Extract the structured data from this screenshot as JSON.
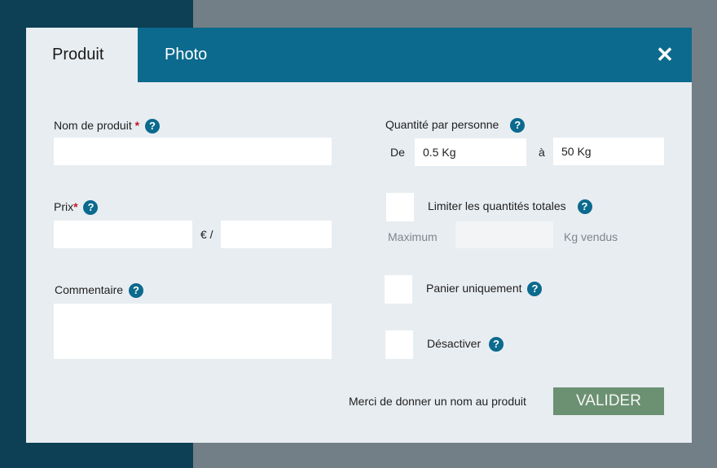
{
  "tabs": {
    "produit": "Produit",
    "photo": "Photo"
  },
  "close_glyph": "✕",
  "help_glyph": "?",
  "required_glyph": "*",
  "fields": {
    "nom": {
      "label": "Nom de produit",
      "value": ""
    },
    "prix": {
      "label": "Prix",
      "price_value": "",
      "currency_sep": "€ /",
      "unit_value": ""
    },
    "commentaire": {
      "label": "Commentaire",
      "value": ""
    },
    "quantite": {
      "label": "Quantité par personne",
      "de_label": "De",
      "de_value": "0.5 Kg",
      "a_label": "à",
      "a_value": "50 Kg"
    },
    "limiter": {
      "label": "Limiter les quantités totales",
      "maximum_label": "Maximum",
      "maximum_value": "",
      "unit_label": "Kg vendus",
      "checked": false
    },
    "panier": {
      "label": "Panier uniquement",
      "checked": false
    },
    "desactiver": {
      "label": "Désactiver",
      "checked": false
    }
  },
  "footer": {
    "message": "Merci de donner un nom au produit",
    "submit_label": "VALIDER"
  },
  "colors": {
    "accent": "#0b6a8d",
    "submit": "#6b9072",
    "required": "#c2172b"
  }
}
